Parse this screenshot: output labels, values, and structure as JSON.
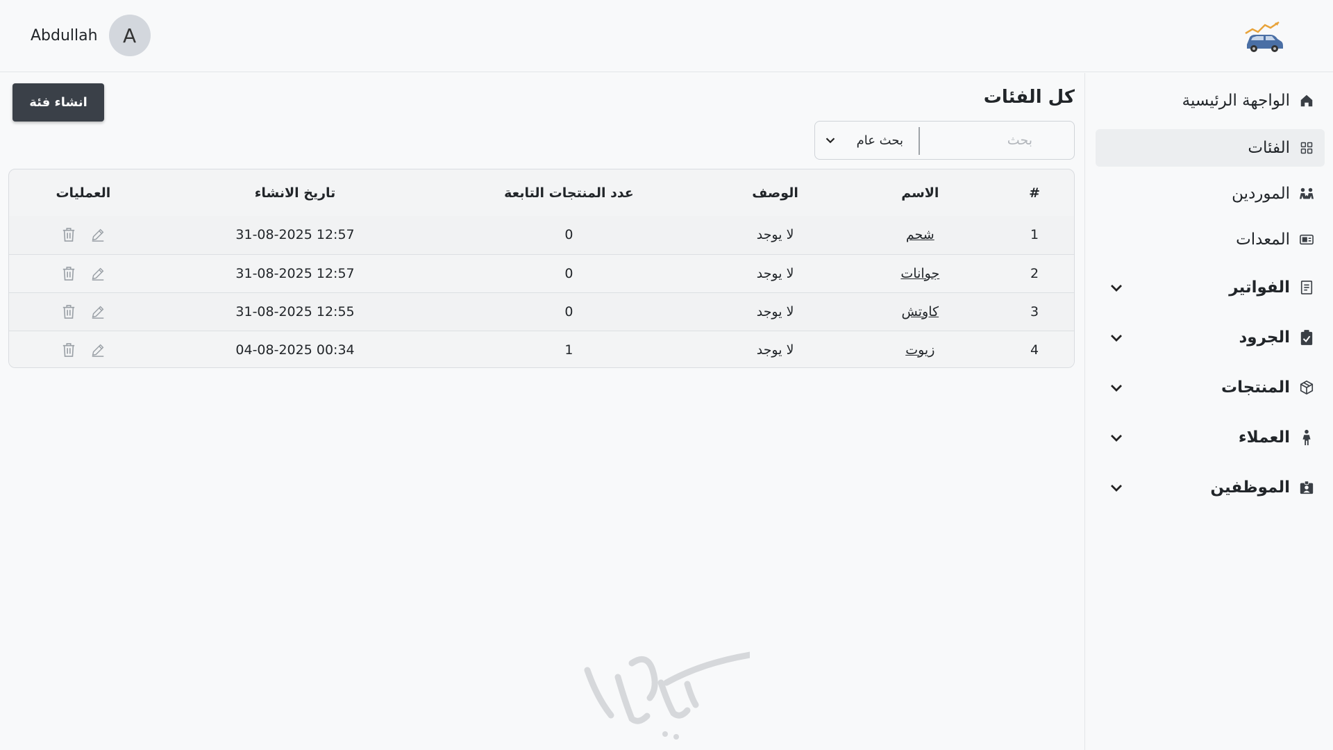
{
  "header": {
    "user_name": "Abdullah",
    "avatar_letter": "A"
  },
  "sidebar": {
    "items": [
      {
        "label": "الواجهة الرئيسية",
        "icon": "home-icon",
        "active": false,
        "expandable": false
      },
      {
        "label": "الفئات",
        "icon": "grid-icon",
        "active": true,
        "expandable": false
      },
      {
        "label": "الموردين",
        "icon": "people-icon",
        "active": false,
        "expandable": false
      },
      {
        "label": "المعدات",
        "icon": "equipment-icon",
        "active": false,
        "expandable": false
      },
      {
        "label": "الفواتير",
        "icon": "invoice-icon",
        "active": false,
        "expandable": true
      },
      {
        "label": "الجرود",
        "icon": "clipboard-check-icon",
        "active": false,
        "expandable": true
      },
      {
        "label": "المنتجات",
        "icon": "box-icon",
        "active": false,
        "expandable": true
      },
      {
        "label": "العملاء",
        "icon": "person-icon",
        "active": false,
        "expandable": true
      },
      {
        "label": "الموظفين",
        "icon": "id-badge-icon",
        "active": false,
        "expandable": true
      }
    ]
  },
  "main": {
    "title": "كل الفئات",
    "create_button": "انشاء فئة",
    "search": {
      "placeholder": "بحث",
      "type_label": "بحث عام"
    },
    "table": {
      "headers": [
        "#",
        "الاسم",
        "الوصف",
        "عدد المنتجات التابعة",
        "تاريخ الانشاء",
        "العمليات"
      ],
      "rows": [
        {
          "index": "1",
          "name": "شحم",
          "description": "لا يوجد",
          "product_count": "0",
          "created": "12:57 31-08-2025"
        },
        {
          "index": "2",
          "name": "جوانات",
          "description": "لا يوجد",
          "product_count": "0",
          "created": "12:57 31-08-2025"
        },
        {
          "index": "3",
          "name": "كاوتش",
          "description": "لا يوجد",
          "product_count": "0",
          "created": "12:55 31-08-2025"
        },
        {
          "index": "4",
          "name": "زيوت",
          "description": "لا يوجد",
          "product_count": "1",
          "created": "00:34 04-08-2025"
        }
      ]
    }
  },
  "colors": {
    "background": "#f8f9fa",
    "button": "#3a4048",
    "progress_accent": "#1e6fc9",
    "icon_muted": "#9aa0a6"
  }
}
